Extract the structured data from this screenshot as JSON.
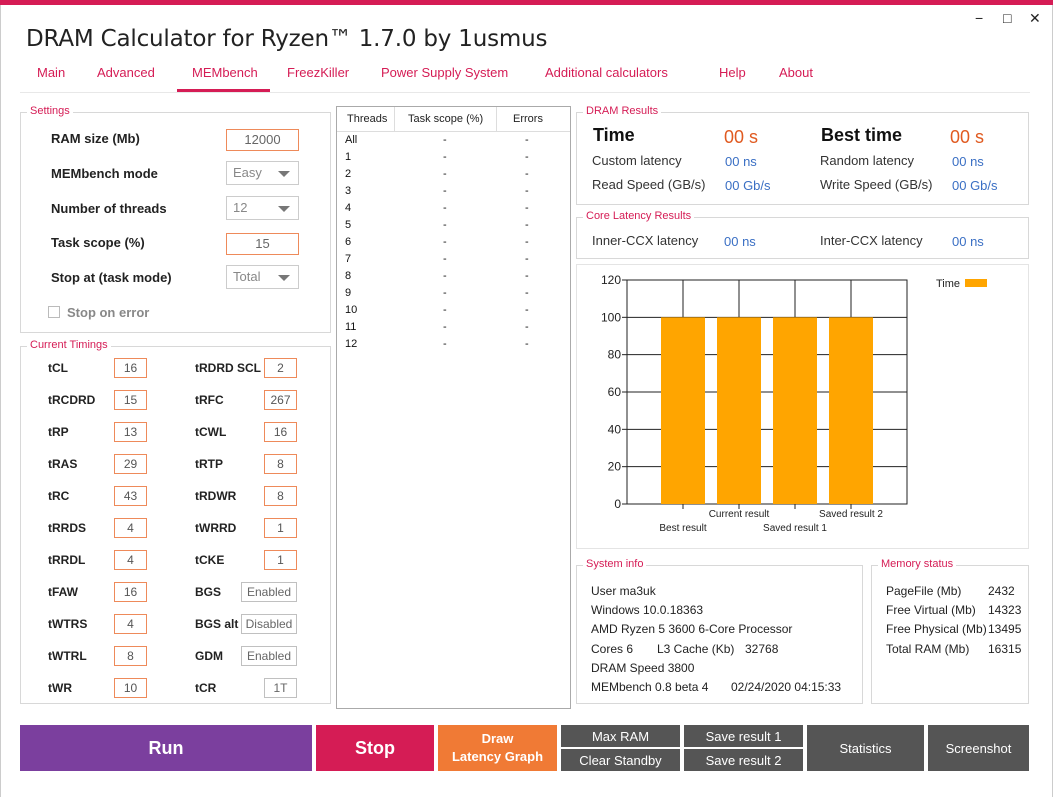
{
  "window": {
    "title": "DRAM Calculator for Ryzen™ 1.7.0 by 1usmus",
    "minimize_glyph": "−",
    "maximize_glyph": "□",
    "close_glyph": "✕"
  },
  "tabs": [
    "Main",
    "Advanced",
    "MEMbench",
    "FreezKiller",
    "Power Supply System",
    "Additional calculators",
    "Help",
    "About"
  ],
  "settings": {
    "title": "Settings",
    "ram_size_label": "RAM size (Mb)",
    "ram_size_value": "12000",
    "mode_label": "MEMbench mode",
    "mode_value": "Easy",
    "threads_label": "Number of threads",
    "threads_value": "12",
    "scope_label": "Task scope (%)",
    "scope_value": "15",
    "stop_at_label": "Stop at (task mode)",
    "stop_at_value": "Total",
    "stop_on_error_label": "Stop on error"
  },
  "timings": {
    "title": "Current Timings",
    "left": [
      {
        "label": "tCL",
        "value": "16"
      },
      {
        "label": "tRCDRD",
        "value": "15"
      },
      {
        "label": "tRP",
        "value": "13"
      },
      {
        "label": "tRAS",
        "value": "29"
      },
      {
        "label": "tRC",
        "value": "43"
      },
      {
        "label": "tRRDS",
        "value": "4"
      },
      {
        "label": "tRRDL",
        "value": "4"
      },
      {
        "label": "tFAW",
        "value": "16"
      },
      {
        "label": "tWTRS",
        "value": "4"
      },
      {
        "label": "tWTRL",
        "value": "8"
      },
      {
        "label": "tWR",
        "value": "10"
      }
    ],
    "right": [
      {
        "label": "tRDRD SCL",
        "value": "2"
      },
      {
        "label": "tRFC",
        "value": "267"
      },
      {
        "label": "tCWL",
        "value": "16"
      },
      {
        "label": "tRTP",
        "value": "8"
      },
      {
        "label": "tRDWR",
        "value": "8"
      },
      {
        "label": "tWRRD",
        "value": "1"
      },
      {
        "label": "tCKE",
        "value": "1"
      },
      {
        "label": "BGS",
        "value": "Enabled"
      },
      {
        "label": "BGS alt",
        "value": "Disabled"
      },
      {
        "label": "GDM",
        "value": "Enabled"
      },
      {
        "label": "tCR",
        "value": "1T"
      }
    ]
  },
  "threads_table": {
    "headers": [
      "Threads",
      "Task scope (%)",
      "Errors"
    ],
    "rows": [
      [
        "All",
        "-",
        "-"
      ],
      [
        "1",
        "-",
        "-"
      ],
      [
        "2",
        "-",
        "-"
      ],
      [
        "3",
        "-",
        "-"
      ],
      [
        "4",
        "-",
        "-"
      ],
      [
        "5",
        "-",
        "-"
      ],
      [
        "6",
        "-",
        "-"
      ],
      [
        "7",
        "-",
        "-"
      ],
      [
        "8",
        "-",
        "-"
      ],
      [
        "9",
        "-",
        "-"
      ],
      [
        "10",
        "-",
        "-"
      ],
      [
        "11",
        "-",
        "-"
      ],
      [
        "12",
        "-",
        "-"
      ]
    ]
  },
  "dram_results": {
    "title": "DRAM Results",
    "time_label": "Time",
    "time_value": "00 s",
    "best_label": "Best time",
    "best_value": "00 s",
    "custom_latency_label": "Custom latency",
    "custom_latency_value": "00 ns",
    "random_latency_label": "Random latency",
    "random_latency_value": "00 ns",
    "read_label": "Read Speed (GB/s)",
    "read_value": "00 Gb/s",
    "write_label": "Write Speed (GB/s)",
    "write_value": "00 Gb/s"
  },
  "core_latency": {
    "title": "Core Latency Results",
    "inner_label": "Inner-CCX latency",
    "inner_value": "00 ns",
    "inter_label": "Inter-CCX latency",
    "inter_value": "00 ns"
  },
  "chart_data": {
    "type": "bar",
    "categories": [
      "Best result",
      "Current result",
      "Saved result 1",
      "Saved result 2"
    ],
    "series": [
      {
        "name": "Time",
        "values": [
          100,
          100,
          100,
          100
        ]
      }
    ],
    "yticks": [
      "120",
      "100",
      "80",
      "60",
      "40",
      "20",
      "0"
    ],
    "ylim": [
      0,
      120
    ],
    "grid": true,
    "legend": "top-right",
    "bar_color": "#ffa500"
  },
  "system_info": {
    "title": "System info",
    "user": "User ma3uk",
    "os": "Windows 10.0.18363",
    "cpu": "AMD Ryzen 5 3600 6-Core Processor",
    "cores": "Cores 6",
    "l3_label": "L3 Cache (Kb)",
    "l3_value": "32768",
    "dram_speed": "DRAM Speed 3800",
    "membench": "MEMbench 0.8 beta 4",
    "datetime": "02/24/2020 04:15:33"
  },
  "memory_status": {
    "title": "Memory status",
    "rows": [
      {
        "label": "PageFile (Mb)",
        "value": "2432"
      },
      {
        "label": "Free Virtual (Mb)",
        "value": "14323"
      },
      {
        "label": "Free Physical (Mb)",
        "value": "13495"
      },
      {
        "label": "Total RAM (Mb)",
        "value": "16315"
      }
    ]
  },
  "buttons": {
    "run": "Run",
    "stop": "Stop",
    "draw_line1": "Draw",
    "draw_line2": "Latency Graph",
    "max_ram": "Max RAM",
    "clear_standby": "Clear Standby",
    "save1": "Save result 1",
    "save2": "Save result 2",
    "statistics": "Statistics",
    "screenshot": "Screenshot"
  },
  "colors": {
    "accent": "#d51c55",
    "run": "#7b3f9e",
    "stop": "#d51c55",
    "draw": "#f07a35",
    "grey_button": "#555555",
    "bar": "#ffa500"
  }
}
